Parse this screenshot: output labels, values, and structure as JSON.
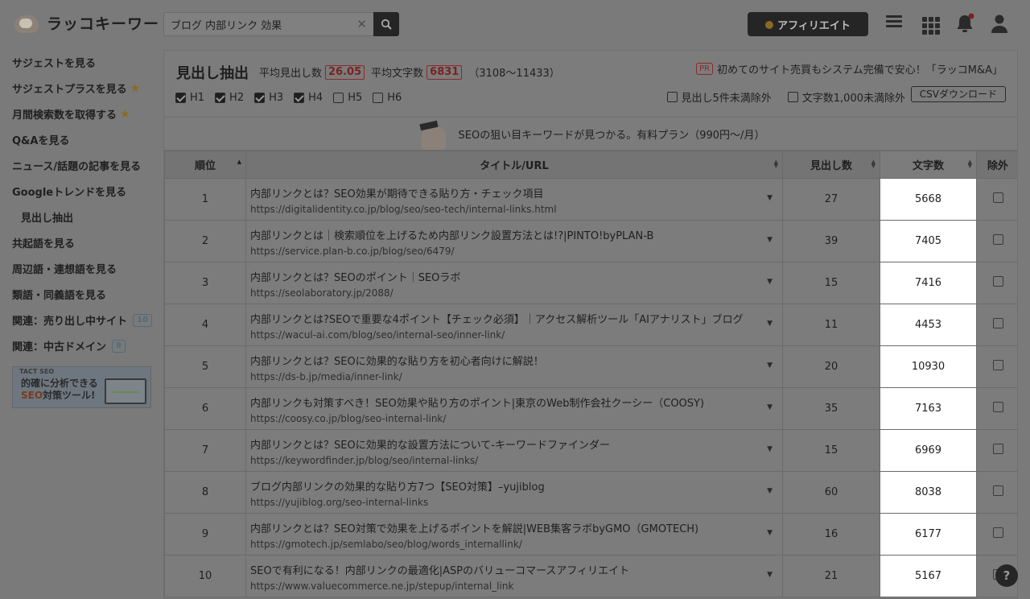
{
  "header": {
    "logo_text": "ラッコキーワード",
    "search_value": "ブログ 内部リンク 効果",
    "clear_glyph": "✕",
    "affiliate_label": "アフィリエイト"
  },
  "sidebar": {
    "items": [
      {
        "label": "サジェストを見る"
      },
      {
        "label": "サジェストプラスを見る"
      },
      {
        "label": "月間検索数を取得する"
      },
      {
        "label": "Q&Aを見る"
      },
      {
        "label": "ニュース/話題の記事を見る"
      },
      {
        "label": "Googleトレンドを見る"
      },
      {
        "label": "見出し抽出"
      },
      {
        "label": "共起語を見る"
      },
      {
        "label": "周辺語・連想語を見る"
      },
      {
        "label": "類語・同義語を見る"
      },
      {
        "label": "関連：売り出し中サイト",
        "badge": "10"
      },
      {
        "label": "関連：中古ドメイン",
        "badge": "9"
      }
    ],
    "banner": {
      "brand": "TACT SEO",
      "line1": "的確に分析できる",
      "line2_accent": "SEO",
      "line2_rest": "対策ツール!"
    }
  },
  "panel": {
    "title": "見出し抽出",
    "avg_headings_label": "平均見出し数",
    "avg_headings_value": "26.05",
    "avg_chars_label": "平均文字数",
    "avg_chars_value": "6831",
    "range": "（3108〜11433）",
    "pr_tag": "PR",
    "pr_text": "初めてのサイト売買もシステム完備で安心！「ラッコM&A」",
    "filters": [
      {
        "label": "H1",
        "checked": true
      },
      {
        "label": "H2",
        "checked": true
      },
      {
        "label": "H3",
        "checked": true
      },
      {
        "label": "H4",
        "checked": true
      },
      {
        "label": "H5",
        "checked": false
      },
      {
        "label": "H6",
        "checked": false
      }
    ],
    "exclude_headings": "見出し5件未満除外",
    "exclude_chars": "文字数1,000未満除外",
    "csv_label": "CSVダウンロード",
    "promo": "SEOの狙い目キーワードが見つかる。有料プラン（990円〜/月）"
  },
  "table": {
    "columns": {
      "rank": "順位",
      "title": "タイトル/URL",
      "headings": "見出し数",
      "chars": "文字数",
      "exclude": "除外"
    },
    "rows": [
      {
        "rank": "1",
        "title": "内部リンクとは？SEO効果が期待できる貼り方・チェック項目",
        "url": "https://digitalidentity.co.jp/blog/seo/seo-tech/internal-links.html",
        "headings": "27",
        "chars": "5668"
      },
      {
        "rank": "2",
        "title": "内部リンクとは｜検索順位を上げるため内部リンク設置方法とは!?|PINTO!byPLAN-B",
        "url": "https://service.plan-b.co.jp/blog/seo/6479/",
        "headings": "39",
        "chars": "7405"
      },
      {
        "rank": "3",
        "title": "内部リンクとは？SEOのポイント｜SEOラボ",
        "url": "https://seolaboratory.jp/2088/",
        "headings": "15",
        "chars": "7416"
      },
      {
        "rank": "4",
        "title": "内部リンクとは?SEOで重要な4ポイント【チェック必須】｜アクセス解析ツール「AIアナリスト」ブログ",
        "url": "https://wacul-ai.com/blog/seo/internal-seo/inner-link/",
        "headings": "11",
        "chars": "4453"
      },
      {
        "rank": "5",
        "title": "内部リンクとは？SEOに効果的な貼り方を初心者向けに解説！",
        "url": "https://ds-b.jp/media/inner-link/",
        "headings": "20",
        "chars": "10930"
      },
      {
        "rank": "6",
        "title": "内部リンクも対策すべき！SEO効果や貼り方のポイント|東京のWeb制作会社クーシー（COOSY)",
        "url": "https://coosy.co.jp/blog/seo-internal-link/",
        "headings": "35",
        "chars": "7163"
      },
      {
        "rank": "7",
        "title": "内部リンクとは？SEOに効果的な設置方法について-キーワードファインダー",
        "url": "https://keywordfinder.jp/blog/seo/internal-links/",
        "headings": "15",
        "chars": "6969"
      },
      {
        "rank": "8",
        "title": "ブログ内部リンクの効果的な貼り方7つ【SEO対策】–yujiblog",
        "url": "https://yujiblog.org/seo-internal-links",
        "headings": "60",
        "chars": "8038"
      },
      {
        "rank": "9",
        "title": "内部リンクとは？SEO対策で効果を上げるポイントを解説|WEB集客ラボbyGMO（GMOTECH)",
        "url": "https://gmotech.jp/semlabo/seo/blog/words_internallink/",
        "headings": "16",
        "chars": "6177"
      },
      {
        "rank": "10",
        "title": "SEOで有利になる！内部リンクの最適化|ASPのバリューコマースアフィリエイト",
        "url": "https://www.valuecommerce.ne.jp/stepup/internal_link",
        "headings": "21",
        "chars": "5167"
      }
    ]
  },
  "help_label": "?"
}
